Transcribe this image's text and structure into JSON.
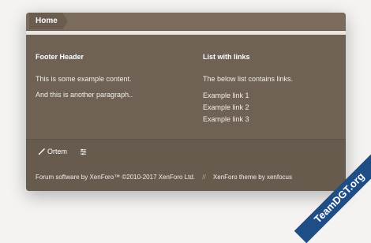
{
  "breadcrumb": {
    "home_label": "Home"
  },
  "footer": {
    "left": {
      "header": "Footer Header",
      "paragraphs": [
        "This is some example content.",
        "And this is another paragraph.."
      ]
    },
    "right": {
      "header": "List with links",
      "intro": "The below list contains links.",
      "links": [
        "Example link 1",
        "Example link 2",
        "Example link 3"
      ]
    }
  },
  "bottom": {
    "style_label": "Ortem",
    "copyright": "Forum software by XenForo™ ©2010-2017 XenForo Ltd.",
    "divider": "//",
    "theme_credit": "XenForo theme by xenfocus"
  },
  "watermark": "TeamDGT.org",
  "colors": {
    "card_bg": "#6f6254",
    "bottom_bg": "#675b4e",
    "watermark_bg": "#1f4e86"
  }
}
